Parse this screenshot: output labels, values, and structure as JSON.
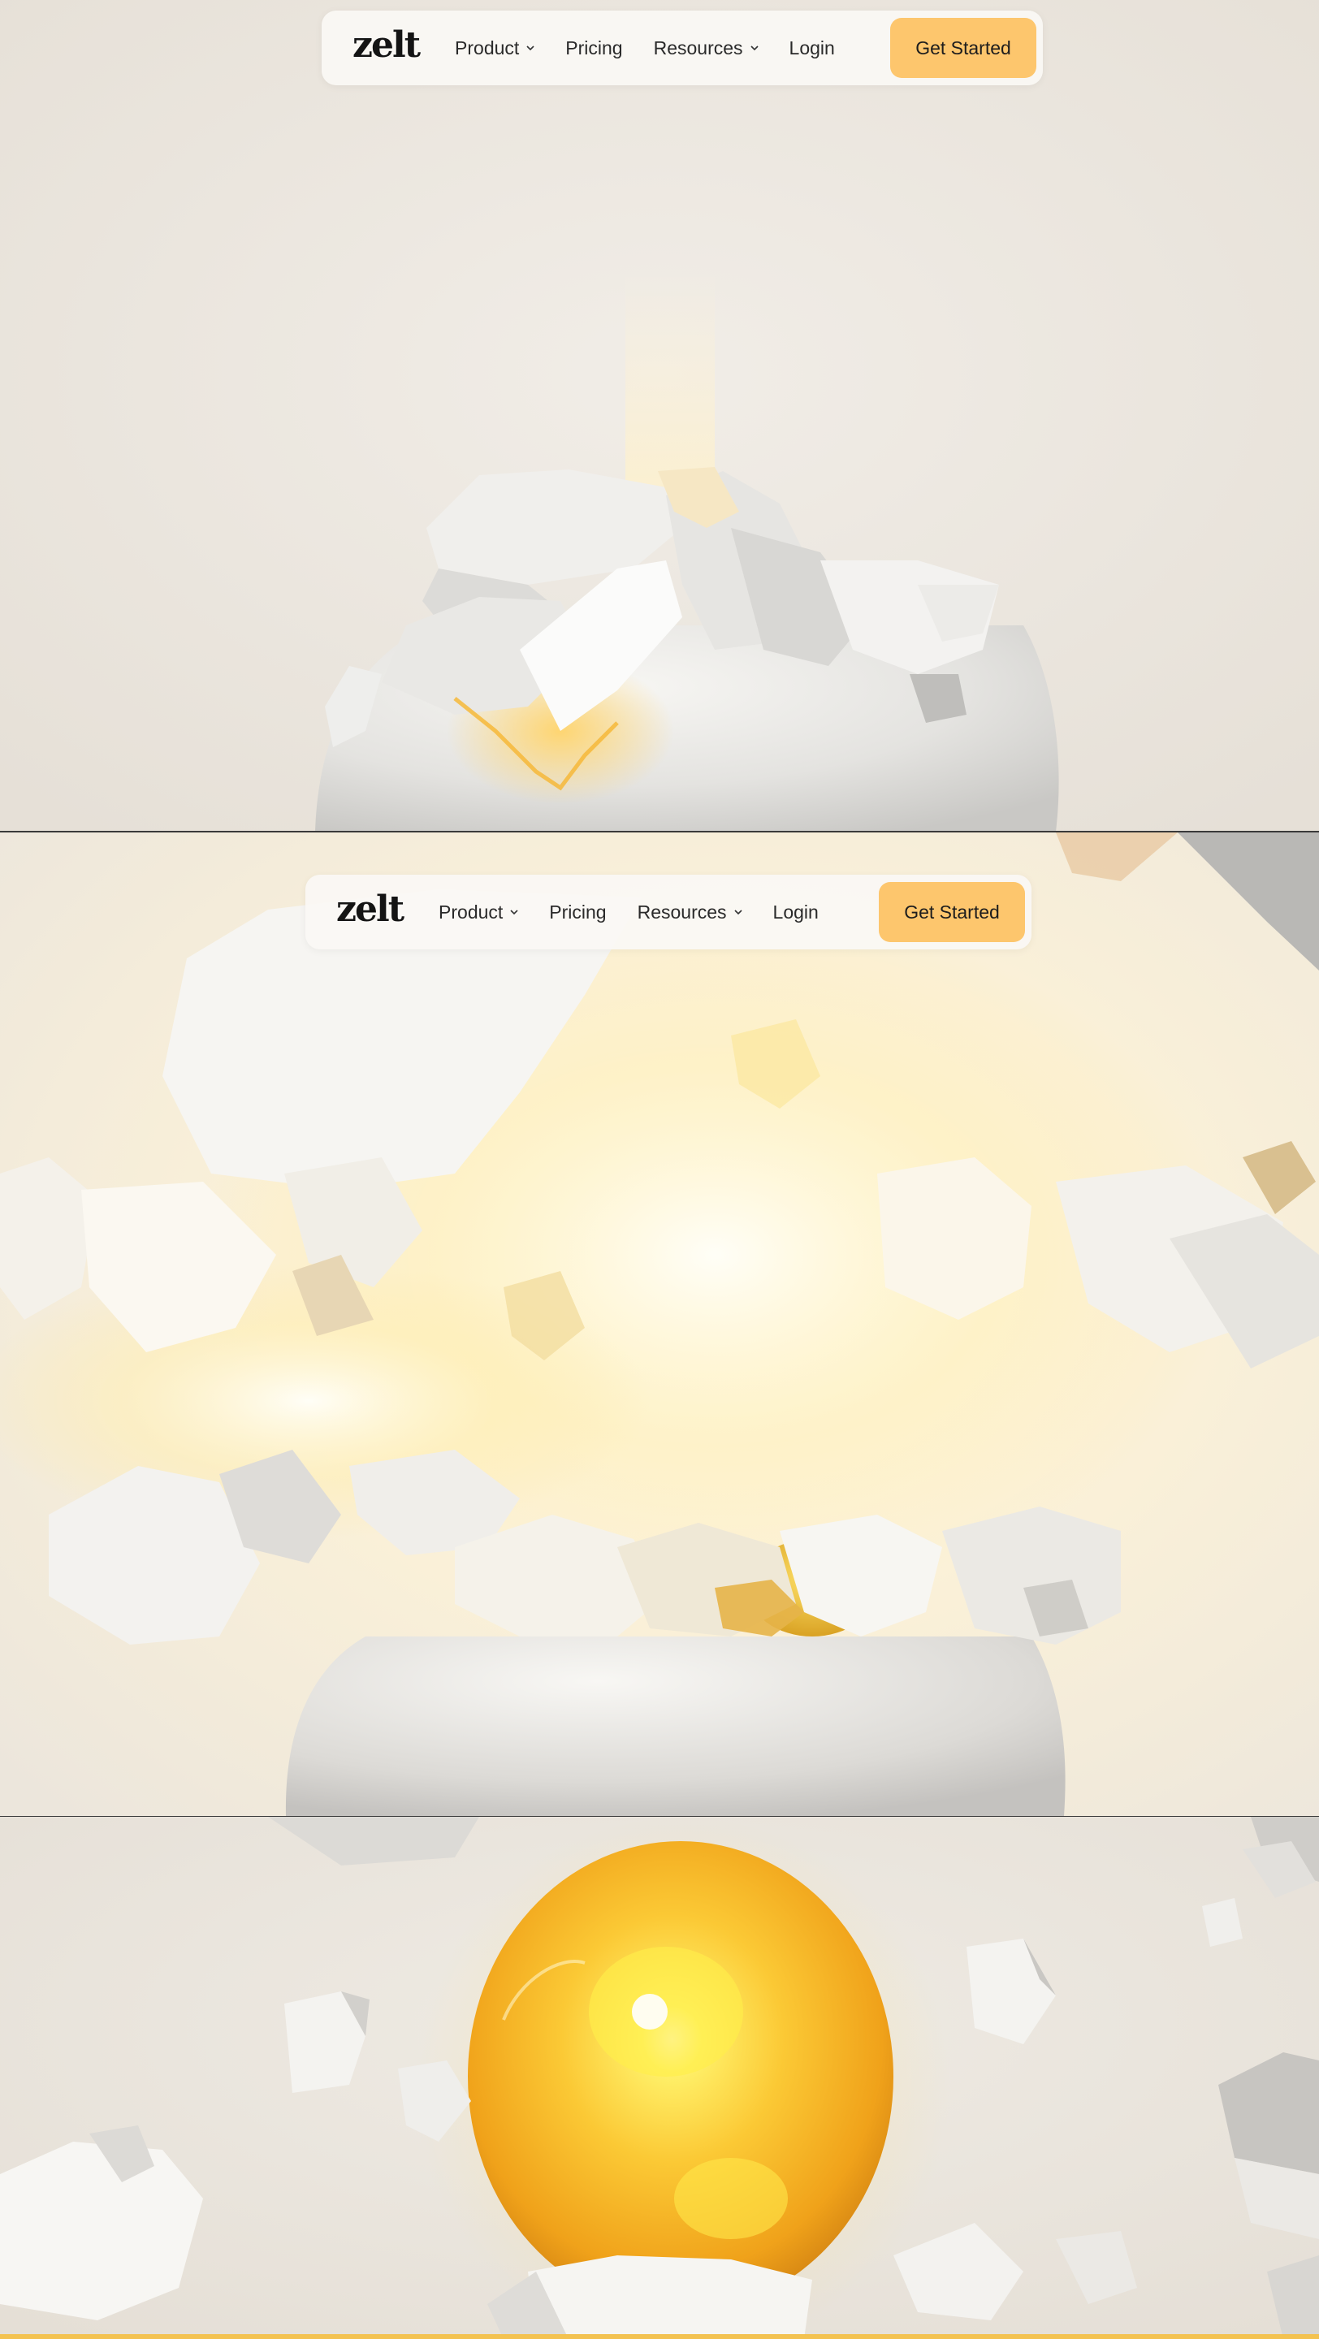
{
  "nav": {
    "logo": "zelt",
    "items": [
      {
        "label": "Product",
        "has_dropdown": true,
        "icon": "chevron-down-icon"
      },
      {
        "label": "Pricing",
        "has_dropdown": false
      },
      {
        "label": "Resources",
        "has_dropdown": true,
        "icon": "chevron-down-icon"
      },
      {
        "label": "Login",
        "has_dropdown": false
      }
    ],
    "cta_label": "Get Started"
  },
  "colors": {
    "background": "#e9e4dc",
    "cta": "#fdc66d",
    "glow": "#ffe9a8",
    "orb": "#f6b21e",
    "orb_highlight": "#ffe84a",
    "shell": "#f6f5f2"
  }
}
